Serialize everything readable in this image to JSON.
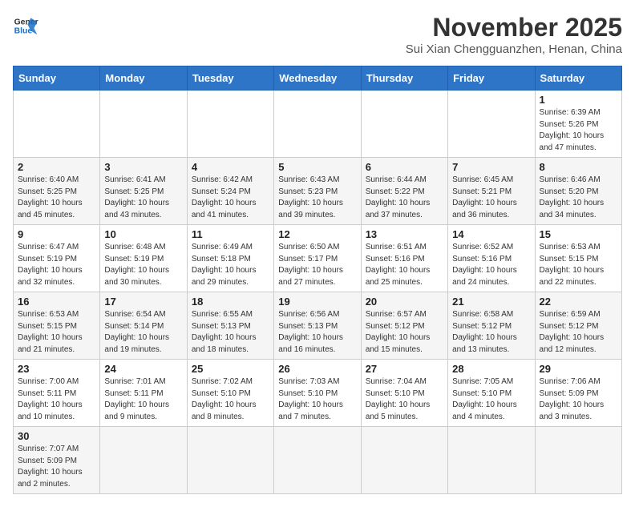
{
  "header": {
    "logo_general": "General",
    "logo_blue": "Blue",
    "month_title": "November 2025",
    "location": "Sui Xian Chengguanzhen, Henan, China"
  },
  "days_of_week": [
    "Sunday",
    "Monday",
    "Tuesday",
    "Wednesday",
    "Thursday",
    "Friday",
    "Saturday"
  ],
  "weeks": [
    [
      {
        "day": "",
        "info": ""
      },
      {
        "day": "",
        "info": ""
      },
      {
        "day": "",
        "info": ""
      },
      {
        "day": "",
        "info": ""
      },
      {
        "day": "",
        "info": ""
      },
      {
        "day": "",
        "info": ""
      },
      {
        "day": "1",
        "info": "Sunrise: 6:39 AM\nSunset: 5:26 PM\nDaylight: 10 hours and 47 minutes."
      }
    ],
    [
      {
        "day": "2",
        "info": "Sunrise: 6:40 AM\nSunset: 5:25 PM\nDaylight: 10 hours and 45 minutes."
      },
      {
        "day": "3",
        "info": "Sunrise: 6:41 AM\nSunset: 5:25 PM\nDaylight: 10 hours and 43 minutes."
      },
      {
        "day": "4",
        "info": "Sunrise: 6:42 AM\nSunset: 5:24 PM\nDaylight: 10 hours and 41 minutes."
      },
      {
        "day": "5",
        "info": "Sunrise: 6:43 AM\nSunset: 5:23 PM\nDaylight: 10 hours and 39 minutes."
      },
      {
        "day": "6",
        "info": "Sunrise: 6:44 AM\nSunset: 5:22 PM\nDaylight: 10 hours and 37 minutes."
      },
      {
        "day": "7",
        "info": "Sunrise: 6:45 AM\nSunset: 5:21 PM\nDaylight: 10 hours and 36 minutes."
      },
      {
        "day": "8",
        "info": "Sunrise: 6:46 AM\nSunset: 5:20 PM\nDaylight: 10 hours and 34 minutes."
      }
    ],
    [
      {
        "day": "9",
        "info": "Sunrise: 6:47 AM\nSunset: 5:19 PM\nDaylight: 10 hours and 32 minutes."
      },
      {
        "day": "10",
        "info": "Sunrise: 6:48 AM\nSunset: 5:19 PM\nDaylight: 10 hours and 30 minutes."
      },
      {
        "day": "11",
        "info": "Sunrise: 6:49 AM\nSunset: 5:18 PM\nDaylight: 10 hours and 29 minutes."
      },
      {
        "day": "12",
        "info": "Sunrise: 6:50 AM\nSunset: 5:17 PM\nDaylight: 10 hours and 27 minutes."
      },
      {
        "day": "13",
        "info": "Sunrise: 6:51 AM\nSunset: 5:16 PM\nDaylight: 10 hours and 25 minutes."
      },
      {
        "day": "14",
        "info": "Sunrise: 6:52 AM\nSunset: 5:16 PM\nDaylight: 10 hours and 24 minutes."
      },
      {
        "day": "15",
        "info": "Sunrise: 6:53 AM\nSunset: 5:15 PM\nDaylight: 10 hours and 22 minutes."
      }
    ],
    [
      {
        "day": "16",
        "info": "Sunrise: 6:53 AM\nSunset: 5:15 PM\nDaylight: 10 hours and 21 minutes."
      },
      {
        "day": "17",
        "info": "Sunrise: 6:54 AM\nSunset: 5:14 PM\nDaylight: 10 hours and 19 minutes."
      },
      {
        "day": "18",
        "info": "Sunrise: 6:55 AM\nSunset: 5:13 PM\nDaylight: 10 hours and 18 minutes."
      },
      {
        "day": "19",
        "info": "Sunrise: 6:56 AM\nSunset: 5:13 PM\nDaylight: 10 hours and 16 minutes."
      },
      {
        "day": "20",
        "info": "Sunrise: 6:57 AM\nSunset: 5:12 PM\nDaylight: 10 hours and 15 minutes."
      },
      {
        "day": "21",
        "info": "Sunrise: 6:58 AM\nSunset: 5:12 PM\nDaylight: 10 hours and 13 minutes."
      },
      {
        "day": "22",
        "info": "Sunrise: 6:59 AM\nSunset: 5:12 PM\nDaylight: 10 hours and 12 minutes."
      }
    ],
    [
      {
        "day": "23",
        "info": "Sunrise: 7:00 AM\nSunset: 5:11 PM\nDaylight: 10 hours and 10 minutes."
      },
      {
        "day": "24",
        "info": "Sunrise: 7:01 AM\nSunset: 5:11 PM\nDaylight: 10 hours and 9 minutes."
      },
      {
        "day": "25",
        "info": "Sunrise: 7:02 AM\nSunset: 5:10 PM\nDaylight: 10 hours and 8 minutes."
      },
      {
        "day": "26",
        "info": "Sunrise: 7:03 AM\nSunset: 5:10 PM\nDaylight: 10 hours and 7 minutes."
      },
      {
        "day": "27",
        "info": "Sunrise: 7:04 AM\nSunset: 5:10 PM\nDaylight: 10 hours and 5 minutes."
      },
      {
        "day": "28",
        "info": "Sunrise: 7:05 AM\nSunset: 5:10 PM\nDaylight: 10 hours and 4 minutes."
      },
      {
        "day": "29",
        "info": "Sunrise: 7:06 AM\nSunset: 5:09 PM\nDaylight: 10 hours and 3 minutes."
      }
    ],
    [
      {
        "day": "30",
        "info": "Sunrise: 7:07 AM\nSunset: 5:09 PM\nDaylight: 10 hours and 2 minutes."
      },
      {
        "day": "",
        "info": ""
      },
      {
        "day": "",
        "info": ""
      },
      {
        "day": "",
        "info": ""
      },
      {
        "day": "",
        "info": ""
      },
      {
        "day": "",
        "info": ""
      },
      {
        "day": "",
        "info": ""
      }
    ]
  ]
}
